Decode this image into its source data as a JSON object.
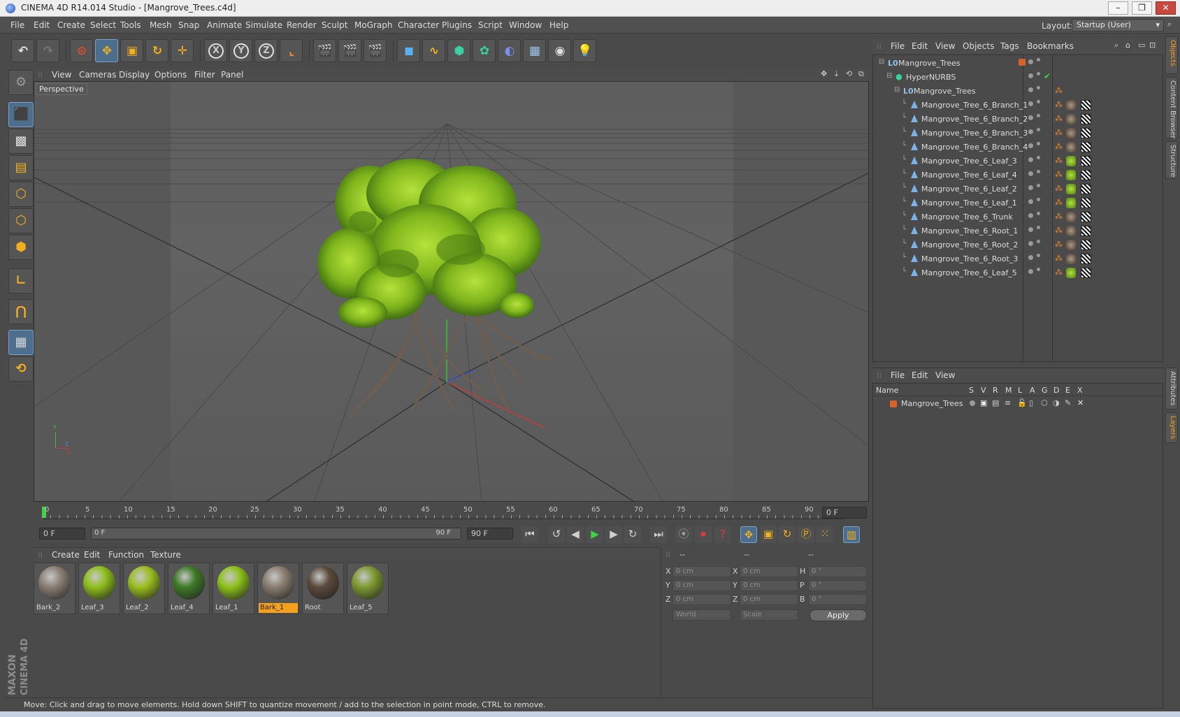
{
  "window": {
    "title": "CINEMA 4D R14.014 Studio - [Mangrove_Trees.c4d]",
    "minimize": "–",
    "restore": "❐",
    "close": "✕"
  },
  "menubar": {
    "items": [
      "File",
      "Edit",
      "Create",
      "Select",
      "Tools",
      "Mesh",
      "Snap",
      "Animate",
      "Simulate",
      "Render",
      "Sculpt",
      "MoGraph",
      "Character",
      "Plugins",
      "Script",
      "Window",
      "Help"
    ],
    "layout_label": "Layout:",
    "layout_value": "Startup (User)"
  },
  "toolbar": {
    "x_label": "X",
    "y_label": "Y",
    "z_label": "Z"
  },
  "viewport": {
    "menu": [
      "View",
      "Cameras",
      "Display",
      "Options",
      "Filter",
      "Panel"
    ],
    "camera_label": "Perspective",
    "axis_y": "Y",
    "axis_x": "X",
    "axis_z": "Z"
  },
  "timeline": {
    "ticks": [
      "0",
      "5",
      "10",
      "15",
      "20",
      "25",
      "30",
      "35",
      "40",
      "45",
      "50",
      "55",
      "60",
      "65",
      "70",
      "75",
      "80",
      "85",
      "90"
    ],
    "current_frame": "0 F"
  },
  "transport": {
    "start_field": "0 F",
    "range_start": "0 F",
    "range_end": "90 F",
    "end_field": "90 F"
  },
  "materials": {
    "menu": [
      "Create",
      "Edit",
      "Function",
      "Texture"
    ],
    "items": [
      {
        "name": "Bark_2",
        "color": "#8a7f74",
        "selected": false
      },
      {
        "name": "Leaf_3",
        "color": "#8fbf1c",
        "selected": false
      },
      {
        "name": "Leaf_2",
        "color": "#9abf1e",
        "selected": false
      },
      {
        "name": "Leaf_4",
        "color": "#3f7a28",
        "selected": false
      },
      {
        "name": "Leaf_1",
        "color": "#8dc21a",
        "selected": false
      },
      {
        "name": "Bark_1",
        "color": "#8a7d70",
        "selected": true
      },
      {
        "name": "Root",
        "color": "#5a4a3c",
        "selected": false
      },
      {
        "name": "Leaf_5",
        "color": "#7e9a30",
        "selected": false
      }
    ]
  },
  "coords": {
    "headers": [
      "--",
      "--",
      "--"
    ],
    "rows": [
      {
        "l1": "X",
        "v1": "0 cm",
        "l2": "X",
        "v2": "0 cm",
        "l3": "H",
        "v3": "0 °"
      },
      {
        "l1": "Y",
        "v1": "0 cm",
        "l2": "Y",
        "v2": "0 cm",
        "l3": "P",
        "v3": "0 °"
      },
      {
        "l1": "Z",
        "v1": "0 cm",
        "l2": "Z",
        "v2": "0 cm",
        "l3": "B",
        "v3": "0 °"
      }
    ],
    "mode1": "World",
    "mode2": "Scale",
    "apply": "Apply"
  },
  "objects": {
    "menu": [
      "File",
      "Edit",
      "View",
      "Objects",
      "Tags",
      "Bookmarks"
    ],
    "rows": [
      {
        "name": "Mangrove_Trees",
        "indent": 0,
        "kind": "null",
        "leaf": false
      },
      {
        "name": "HyperNURBS",
        "indent": 1,
        "kind": "nurbs",
        "leaf": false
      },
      {
        "name": "Mangrove_Trees",
        "indent": 2,
        "kind": "null",
        "leaf": false
      },
      {
        "name": "Mangrove_Tree_6_Branch_1",
        "indent": 3,
        "kind": "poly",
        "leaf": false
      },
      {
        "name": "Mangrove_Tree_6_Branch_2",
        "indent": 3,
        "kind": "poly",
        "leaf": false
      },
      {
        "name": "Mangrove_Tree_6_Branch_3",
        "indent": 3,
        "kind": "poly",
        "leaf": false
      },
      {
        "name": "Mangrove_Tree_6_Branch_4",
        "indent": 3,
        "kind": "poly",
        "leaf": false
      },
      {
        "name": "Mangrove_Tree_6_Leaf_3",
        "indent": 3,
        "kind": "poly",
        "leaf": true
      },
      {
        "name": "Mangrove_Tree_6_Leaf_4",
        "indent": 3,
        "kind": "poly",
        "leaf": true
      },
      {
        "name": "Mangrove_Tree_6_Leaf_2",
        "indent": 3,
        "kind": "poly",
        "leaf": true
      },
      {
        "name": "Mangrove_Tree_6_Leaf_1",
        "indent": 3,
        "kind": "poly",
        "leaf": true
      },
      {
        "name": "Mangrove_Tree_6_Trunk",
        "indent": 3,
        "kind": "poly",
        "leaf": false
      },
      {
        "name": "Mangrove_Tree_6_Root_1",
        "indent": 3,
        "kind": "poly",
        "leaf": false
      },
      {
        "name": "Mangrove_Tree_6_Root_2",
        "indent": 3,
        "kind": "poly",
        "leaf": false
      },
      {
        "name": "Mangrove_Tree_6_Root_3",
        "indent": 3,
        "kind": "poly",
        "leaf": false
      },
      {
        "name": "Mangrove_Tree_6_Leaf_5",
        "indent": 3,
        "kind": "poly",
        "leaf": true
      }
    ]
  },
  "layers": {
    "menu": [
      "File",
      "Edit",
      "View"
    ],
    "columns": [
      "Name",
      "S",
      "V",
      "R",
      "M",
      "L",
      "A",
      "G",
      "D",
      "E",
      "X"
    ],
    "rows": [
      {
        "name": "Mangrove_Trees"
      }
    ]
  },
  "sidetabs": [
    "Objects",
    "Content Browser",
    "Structure",
    "Attributes",
    "Layers"
  ],
  "brand": {
    "line1": "MAXON",
    "line2": "CINEMA 4D"
  },
  "status": "Move: Click and drag to move elements. Hold down SHIFT to quantize movement / add to the selection in point mode, CTRL to remove."
}
